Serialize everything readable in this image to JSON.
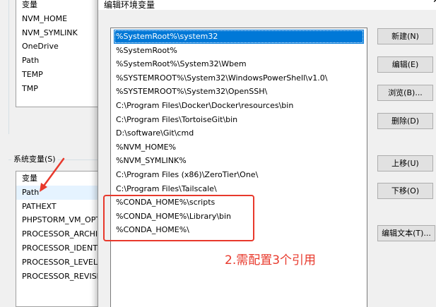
{
  "background_window": {
    "user_vars": {
      "header": "变量",
      "rows": [
        "NVM_HOME",
        "NVM_SYMLINK",
        "OneDrive",
        "Path",
        "TEMP",
        "TMP"
      ]
    },
    "system_group_label": "系统变量(S)",
    "system_vars": {
      "header": "变量",
      "rows": [
        "Path",
        "PATHEXT",
        "PHPSTORM_VM_OPTIONS",
        "PROCESSOR_ARCHITECTURE",
        "PROCESSOR_IDENTIFIER",
        "PROCESSOR_LEVEL",
        "PROCESSOR_REVISION"
      ],
      "selected_index": 0
    }
  },
  "dialog": {
    "title": "编辑环境变量",
    "close_glyph": "✕",
    "paths": [
      "%SystemRoot%\\system32",
      "%SystemRoot%",
      "%SystemRoot%\\System32\\Wbem",
      "%SYSTEMROOT%\\System32\\WindowsPowerShell\\v1.0\\",
      "%SYSTEMROOT%\\System32\\OpenSSH\\",
      "C:\\Program Files\\Docker\\Docker\\resources\\bin",
      "C:\\Program Files\\TortoiseGit\\bin",
      "D:\\software\\Git\\cmd",
      "%NVM_HOME%",
      "%NVM_SYMLINK%",
      "C:\\Program Files (x86)\\ZeroTier\\One\\",
      "C:\\Program Files\\Tailscale\\",
      "%CONDA_HOME%\\scripts",
      "%CONDA_HOME%\\Library\\bin",
      "%CONDA_HOME%\\"
    ],
    "selected_index": 0,
    "buttons": {
      "new": "新建(N)",
      "edit": "编辑(E)",
      "browse": "浏览(B)...",
      "delete": "删除(D)",
      "move_up": "上移(U)",
      "move_down": "下移(O)",
      "edit_text": "编辑文本(T)..."
    }
  },
  "annotation": {
    "text": "2.需配置3个引用",
    "color": "#e8392c"
  },
  "colors": {
    "selection": "#0078d7",
    "row_hover": "#e5f3ff",
    "annotation": "#e8392c"
  }
}
